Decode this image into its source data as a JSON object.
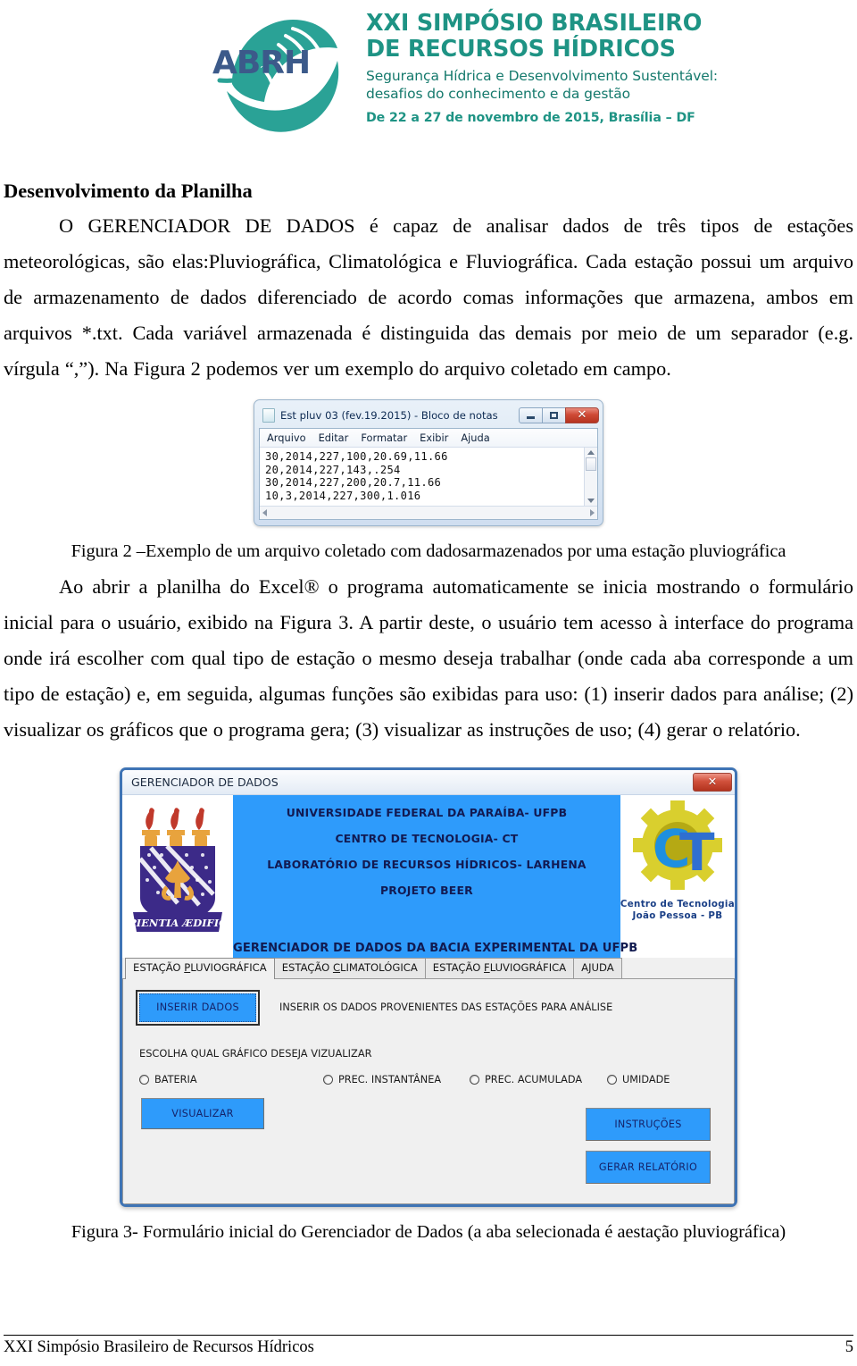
{
  "header": {
    "logo_alt": "abrh-logo",
    "title_line1": "XXI SIMPÓSIO BRASILEIRO",
    "title_line2": "DE RECURSOS HÍDRICOS",
    "subtitle_line1": "Segurança Hídrica e Desenvolvimento Sustentável:",
    "subtitle_line2": "desafios do conhecimento e da gestão",
    "date_line": "De 22 a 27 de novembro de 2015, Brasília – DF",
    "brand_teal": "#1e9384"
  },
  "document": {
    "section_heading": "Desenvolvimento da Planilha",
    "paragraph1": "O GERENCIADOR DE DADOS é capaz de analisar dados de três tipos de estações meteorológicas, são elas:Pluviográfica, Climatológica e Fluviográfica. Cada estação possui um arquivo de armazenamento de dados diferenciado de acordo comas informações que armazena, ambos em arquivos *.txt. Cada variável armazenada é distinguida das demais por meio de um separador (e.g. vírgula “,”). Na Figura 2 podemos ver um exemplo do arquivo coletado em campo.",
    "figure2_caption": "Figura 2 –Exemplo de um arquivo coletado com dadosarmazenados por uma estação pluviográfica",
    "paragraph2": "Ao abrir a planilha do Excel® o programa automaticamente se inicia mostrando o formulário inicial para o usuário, exibido na Figura 3. A partir deste, o usuário tem acesso à interface do programa onde irá escolher com qual tipo de estação o mesmo deseja trabalhar (onde cada aba corresponde a um tipo de estação) e, em seguida, algumas funções são exibidas para uso: (1) inserir dados para análise; (2) visualizar os gráficos que o programa gera; (3) visualizar as instruções de uso; (4) gerar o relatório.",
    "figure3_caption": "Figura 3- Formulário inicial do Gerenciador de Dados (a aba selecionada é aestação pluviográfica)"
  },
  "notepad": {
    "title": "Est pluv 03 (fev.19.2015) - Bloco de notas",
    "menus": [
      "Arquivo",
      "Editar",
      "Formatar",
      "Exibir",
      "Ajuda"
    ],
    "content_lines": [
      "30,2014,227,100,20.69,11.66",
      "20,2014,227,143,.254",
      "30,2014,227,200,20.7,11.66",
      "10,3,2014,227,300,1.016"
    ],
    "content_text": "30,2014,227,100,20.69,11.66\n20,2014,227,143,.254\n30,2014,227,200,20.7,11.66\n10,3,2014,227,300,1.016",
    "window_buttons": [
      "minimize-icon",
      "maximize-icon",
      "close-icon"
    ]
  },
  "app": {
    "title": "GERENCIADOR DE DADOS",
    "close_label": "✕",
    "accent_blue": "#2e9bfb",
    "banner": {
      "line1": "UNIVERSIDADE FEDERAL DA PARAÍBA- UFPB",
      "line2": "CENTRO DE TECNOLOGIA- CT",
      "line3": "LABORATÓRIO DE RECURSOS HÍDRICOS- LARHENA",
      "line4": "PROJETO BEER",
      "footer_line": "GERENCIADOR DE DADOS DA BACIA EXPERIMENTAL DA UFPB",
      "crest_motto": "SAPIENTIA ÆDIFICAT",
      "ct_caption_line1": "Centro de Tecnologia",
      "ct_caption_line2": "João Pessoa - PB",
      "ct_letters": "CT"
    },
    "tabs": [
      {
        "label": "ESTAÇÃO PLUVIOGRÁFICA",
        "pre": "ESTAÇÃO ",
        "accel": "P",
        "post": "LUVIOGRÁFICA",
        "selected": true
      },
      {
        "label": "ESTAÇÃO CLIMATOLÓGICA",
        "pre": "ESTAÇÃO ",
        "accel": "C",
        "post": "LIMATOLÓGICA",
        "selected": false
      },
      {
        "label": "ESTAÇÃO FLUVIOGRÁFICA",
        "pre": "ESTAÇÃO ",
        "accel": "F",
        "post": "LUVIOGRÁFICA",
        "selected": false
      },
      {
        "label": "AJUDA",
        "pre": "AJUDA",
        "accel": "",
        "post": "",
        "selected": false
      }
    ],
    "insert_button": "INSERIR DADOS",
    "insert_description": "INSERIR OS DADOS PROVENIENTES DAS ESTAÇÕES PARA ANÁLISE",
    "chart_prompt": "ESCOLHA QUAL GRÁFICO DESEJA VIZUALIZAR",
    "radio_options": [
      "BATERIA",
      "PREC. INSTANTÂNEA",
      "PREC. ACUMULADA",
      "UMIDADE"
    ],
    "visualize_button": "VISUALIZAR",
    "instructions_button": "INSTRUÇÕES",
    "report_button": "GERAR RELATÓRIO"
  },
  "footer": {
    "left": "XXI Simpósio Brasileiro de Recursos Hídricos",
    "page_number": "5"
  }
}
